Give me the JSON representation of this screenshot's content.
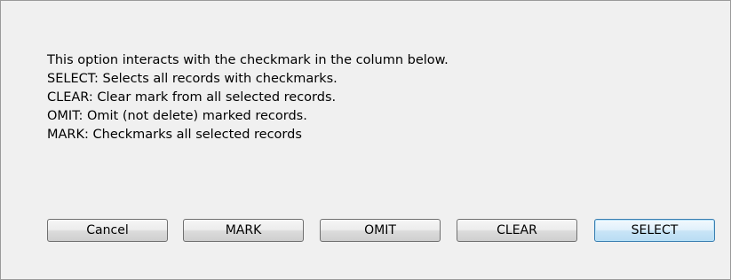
{
  "message": {
    "lines": [
      "This option interacts with the checkmark in the column below.",
      "SELECT: Selects all records with checkmarks.",
      "CLEAR: Clear mark from all selected records.",
      "OMIT: Omit (not delete) marked records.",
      "MARK: Checkmarks all selected records"
    ]
  },
  "buttons": {
    "cancel": "Cancel",
    "mark": "MARK",
    "omit": "OMIT",
    "clear": "CLEAR",
    "select": "SELECT"
  },
  "colors": {
    "dialog_background": "#f0f0f0",
    "default_button_accent": "#3c7fb1"
  }
}
